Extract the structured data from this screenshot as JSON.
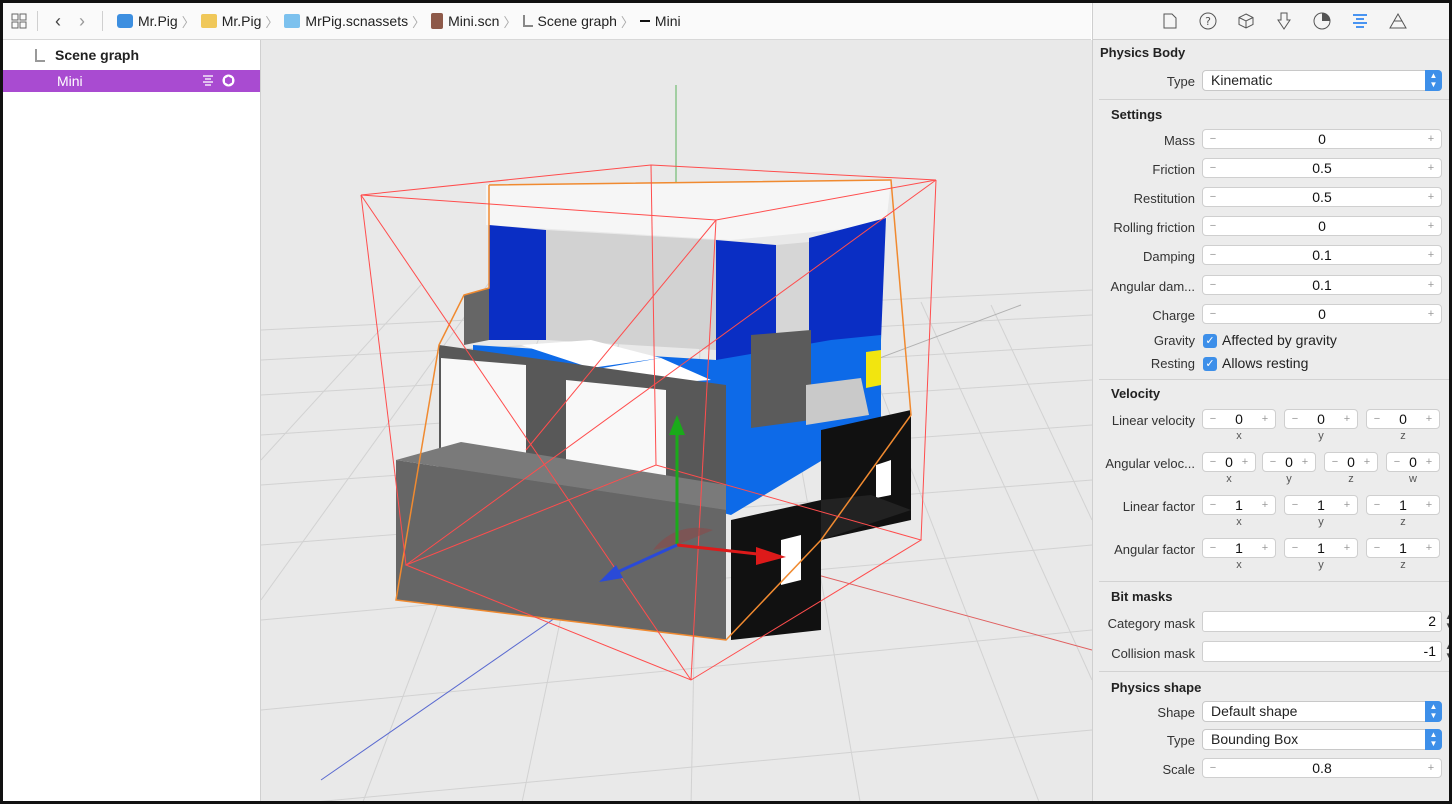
{
  "jumpbar": {
    "crumbs": [
      {
        "label": "Mr.Pig",
        "icon": "app-icon"
      },
      {
        "label": "Mr.Pig",
        "icon": "folder-icon"
      },
      {
        "label": "MrPig.scnassets",
        "icon": "folder-icon"
      },
      {
        "label": "Mini.scn",
        "icon": "scene-file-icon"
      },
      {
        "label": "Scene graph",
        "icon": "tree-icon"
      },
      {
        "label": "Mini",
        "icon": "node-icon"
      }
    ]
  },
  "scene_graph": {
    "header": "Scene graph",
    "selected_node": "Mini"
  },
  "inspector": {
    "physics_body": {
      "title": "Physics Body",
      "type_label": "Type",
      "type_value": "Kinematic"
    },
    "settings": {
      "title": "Settings",
      "rows": [
        {
          "label": "Mass",
          "value": "0"
        },
        {
          "label": "Friction",
          "value": "0.5"
        },
        {
          "label": "Restitution",
          "value": "0.5"
        },
        {
          "label": "Rolling friction",
          "value": "0"
        },
        {
          "label": "Damping",
          "value": "0.1"
        },
        {
          "label": "Angular dam...",
          "value": "0.1"
        },
        {
          "label": "Charge",
          "value": "0"
        }
      ],
      "gravity_label": "Gravity",
      "gravity_text": "Affected by gravity",
      "resting_label": "Resting",
      "resting_text": "Allows resting"
    },
    "velocity": {
      "title": "Velocity",
      "linear_velocity": {
        "label": "Linear velocity",
        "x": "0",
        "y": "0",
        "z": "0"
      },
      "angular_velocity": {
        "label": "Angular veloc...",
        "x": "0",
        "y": "0",
        "z": "0",
        "w": "0"
      },
      "linear_factor": {
        "label": "Linear factor",
        "x": "1",
        "y": "1",
        "z": "1"
      },
      "angular_factor": {
        "label": "Angular factor",
        "x": "1",
        "y": "1",
        "z": "1"
      },
      "axis_x": "x",
      "axis_y": "y",
      "axis_z": "z",
      "axis_w": "w"
    },
    "bit_masks": {
      "title": "Bit masks",
      "category_label": "Category mask",
      "category_value": "2",
      "collision_label": "Collision mask",
      "collision_value": "-1"
    },
    "physics_shape": {
      "title": "Physics shape",
      "shape_label": "Shape",
      "shape_value": "Default shape",
      "type_label": "Type",
      "type_value": "Bounding Box",
      "scale_label": "Scale",
      "scale_value": "0.8"
    }
  },
  "colors": {
    "selection": "#a94bd1",
    "accent": "#3d8fe9",
    "viewport_bg": "#e9e9e9"
  }
}
